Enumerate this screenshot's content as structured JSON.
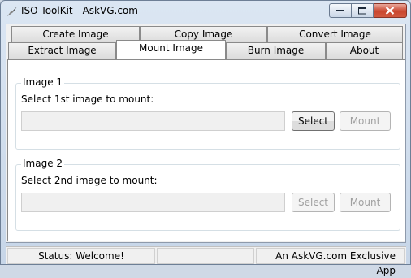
{
  "window": {
    "title": "ISO ToolKit - AskVG.com",
    "controls": {
      "minimize_icon": "minimize-icon",
      "maximize_icon": "maximize-icon",
      "close_icon": "close-icon"
    }
  },
  "tabs": {
    "row1": [
      "Create Image",
      "Copy Image",
      "Convert Image"
    ],
    "row2": [
      "Extract Image",
      "Mount Image",
      "Burn Image",
      "About"
    ],
    "active": "Mount Image"
  },
  "image1": {
    "legend": "Image 1",
    "prompt": "Select 1st image to mount:",
    "path_value": "",
    "select_label": "Select",
    "mount_label": "Mount"
  },
  "image2": {
    "legend": "Image 2",
    "prompt": "Select 2nd image to mount:",
    "path_value": "",
    "select_label": "Select",
    "mount_label": "Mount"
  },
  "status": {
    "left": "Status: Welcome!",
    "middle": "",
    "right": "An AskVG.com Exclusive App"
  },
  "colors": {
    "close_button": "#c9462f",
    "titlebar": "#dbe6f3"
  }
}
